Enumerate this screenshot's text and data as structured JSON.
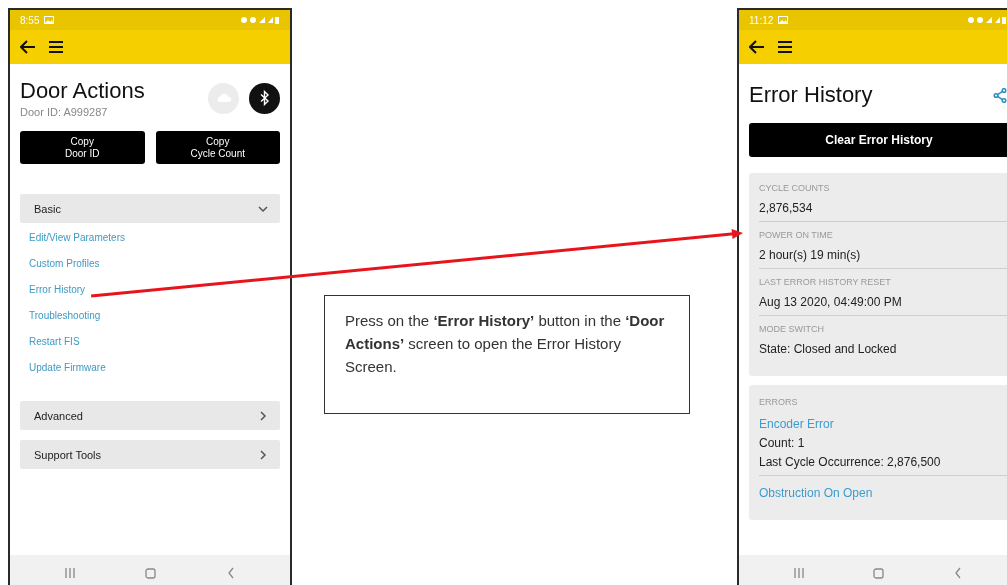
{
  "left_phone": {
    "status_bar": {
      "time": "8:55"
    },
    "title": "Door Actions",
    "subtitle": "Door ID: A999287",
    "buttons": [
      {
        "lines": [
          "Copy",
          "Door ID"
        ]
      },
      {
        "lines": [
          "Copy",
          "Cycle Count"
        ]
      }
    ],
    "sections": [
      {
        "label": "Basic",
        "expanded": true,
        "items": [
          "Edit/View Parameters",
          "Custom Profiles",
          "Error History",
          "Troubleshooting",
          "Restart FIS",
          "Update Firmware"
        ]
      },
      {
        "label": "Advanced",
        "expanded": false
      },
      {
        "label": "Support Tools",
        "expanded": false
      }
    ]
  },
  "callout": {
    "text": "Press on the **‘Error History’** button in the **‘Door Actions’** screen to open the Error History Screen."
  },
  "right_phone": {
    "status_bar": {
      "time": "11:12"
    },
    "title": "Error History",
    "button": "Clear Error History",
    "info": [
      {
        "label": "CYCLE COUNTS",
        "value": "2,876,534"
      },
      {
        "label": "POWER ON TIME",
        "value": "2 hour(s) 19 min(s)"
      },
      {
        "label": "LAST ERROR HISTORY RESET",
        "value": "Aug 13 2020, 04:49:00 PM"
      },
      {
        "label": "MODE SWITCH",
        "value": "State: Closed and Locked"
      }
    ],
    "errors": {
      "heading": "ERRORS",
      "items": [
        {
          "name": "Encoder Error",
          "count": "Count: 1",
          "last": "Last Cycle Occurrence: 2,876,500"
        },
        {
          "name": "Obstruction On Open"
        }
      ]
    }
  }
}
